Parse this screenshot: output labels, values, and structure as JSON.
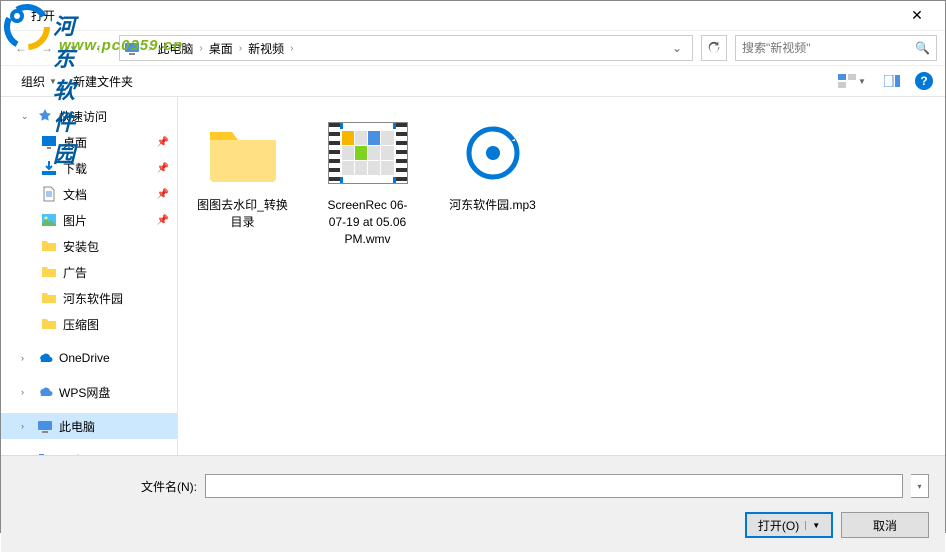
{
  "watermark": {
    "name": "河东软件园",
    "url": "www.pc0359.cn"
  },
  "title": "打开",
  "breadcrumb": {
    "items": [
      "此电脑",
      "桌面",
      "新视频"
    ]
  },
  "search": {
    "placeholder": "搜索\"新视频\""
  },
  "toolbar": {
    "organize": "组织",
    "newfolder": "新建文件夹"
  },
  "sidebar": {
    "quickaccess": "快速访问",
    "desktop": "桌面",
    "downloads": "下载",
    "documents": "文档",
    "pictures": "图片",
    "pkg": "安装包",
    "ads": "广告",
    "hdsoft": "河东软件园",
    "thumbs": "压缩图",
    "onedrive": "OneDrive",
    "wps": "WPS网盘",
    "thispc": "此电脑",
    "network": "网络"
  },
  "files": [
    {
      "name": "图图去水印_转换目录",
      "type": "folder"
    },
    {
      "name": "ScreenRec 06-07-19 at 05.06 PM.wmv",
      "type": "video"
    },
    {
      "name": "河东软件园.mp3",
      "type": "audio"
    }
  ],
  "bottom": {
    "filename_label": "文件名(N):",
    "open": "打开(O)",
    "cancel": "取消"
  }
}
